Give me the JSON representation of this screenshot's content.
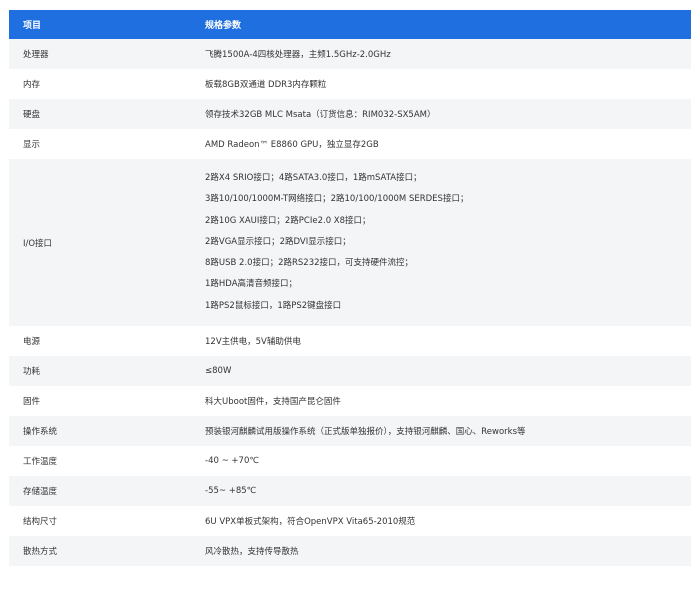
{
  "table": {
    "headers": [
      "项目",
      "规格参数"
    ],
    "rows": [
      {
        "label": "处理器",
        "value": "飞腾1500A-4四核处理器，主频1.5GHz-2.0GHz"
      },
      {
        "label": "内存",
        "value": "板载8GB双通道 DDR3内存颗粒"
      },
      {
        "label": "硬盘",
        "value": "领存技术32GB MLC Msata（订货信息：RIM032-SX5AM）"
      },
      {
        "label": "显示",
        "value": "AMD Radeon™ E8860 GPU，独立显存2GB"
      },
      {
        "label": "I/O接口",
        "lines": [
          "2路X4 SRIO接口；4路SATA3.0接口，1路mSATA接口；",
          "3路10/100/1000M-T网络接口；2路10/100/1000M SERDES接口；",
          "2路10G XAUI接口；2路PCIe2.0 X8接口；",
          "2路VGA显示接口；2路DVI显示接口；",
          "8路USB 2.0接口；2路RS232接口，可支持硬件流控；",
          "1路HDA高清音频接口；",
          "1路PS2鼠标接口，1路PS2键盘接口"
        ]
      },
      {
        "label": "电源",
        "value": "12V主供电，5V辅助供电"
      },
      {
        "label": "功耗",
        "value": "≤80W"
      },
      {
        "label": "固件",
        "value": "科大Uboot固件，支持国产昆仑固件"
      },
      {
        "label": "操作系统",
        "value": "预装银河麒麟试用版操作系统（正式版单独报价），支持银河麒麟、国心、Reworks等"
      },
      {
        "label": "工作温度",
        "value": "-40 ~ +70℃"
      },
      {
        "label": "存储温度",
        "value": "-55~ +85℃"
      },
      {
        "label": "结构尺寸",
        "value": "6U VPX单板式架构，符合OpenVPX Vita65-2010规范"
      },
      {
        "label": "散热方式",
        "value": "风冷散热，支持传导散热"
      }
    ]
  }
}
